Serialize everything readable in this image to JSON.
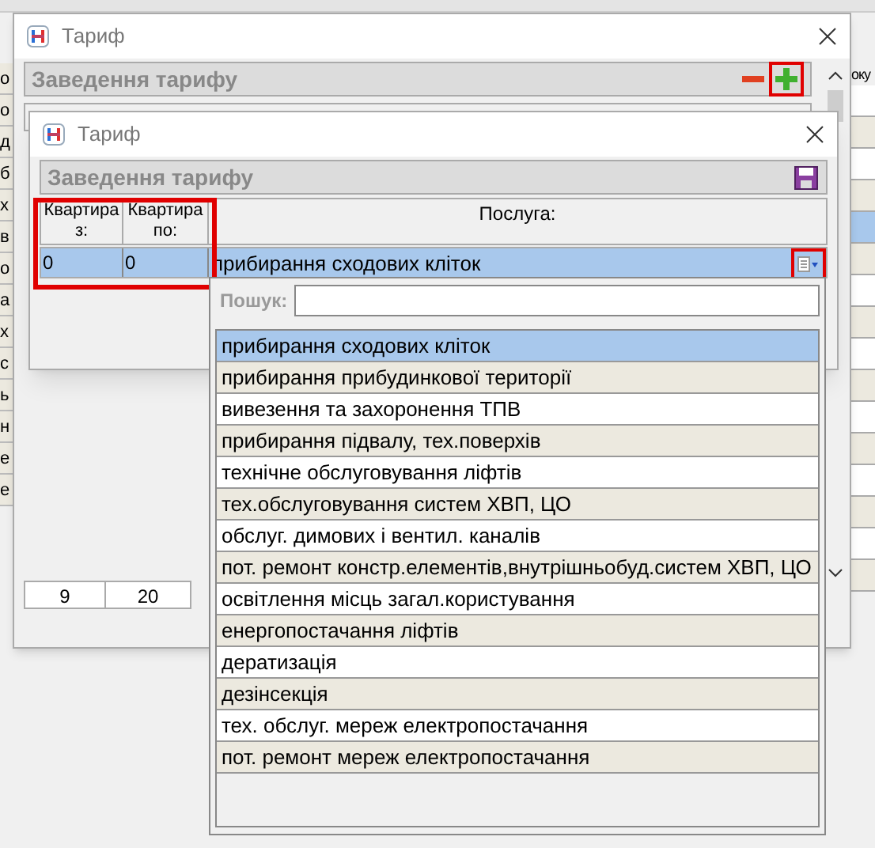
{
  "background": {
    "left_fragments": [
      "о",
      "о",
      "д",
      "б",
      "х",
      "в",
      "о",
      "а",
      "х",
      "с",
      "ь",
      "н",
      "е",
      "е"
    ],
    "right_fragment": "оку"
  },
  "back_window": {
    "title": "Тариф",
    "panel_title": "Заведення тарифу",
    "row": [
      "9",
      "20"
    ]
  },
  "front_window": {
    "title": "Тариф",
    "panel_title": "Заведення тарифу",
    "columns": [
      "Квартира з:",
      "Квартира по:",
      "Послуга:"
    ],
    "row": {
      "from": "0",
      "to": "0",
      "service": "прибирання сходових кліток",
      "selected": true
    }
  },
  "dropdown": {
    "search_label": "Пошук:",
    "items": [
      {
        "label": "прибирання сходових кліток",
        "selected": true
      },
      {
        "label": "прибирання прибудинкової території",
        "selected": false
      },
      {
        "label": "вивезення та захоронення ТПВ",
        "selected": false
      },
      {
        "label": "прибирання підвалу, тех.поверхів",
        "selected": false
      },
      {
        "label": "технічне обслуговування ліфтів",
        "selected": false
      },
      {
        "label": "тех.обслуговування систем ХВП, ЦО",
        "selected": false
      },
      {
        "label": "обслуг. димових і вентил. каналів",
        "selected": false
      },
      {
        "label": "пот. ремонт констр.елементів,внутрішньобуд.систем ХВП, ЦО",
        "selected": false
      },
      {
        "label": "освітлення місць загал.користування",
        "selected": false
      },
      {
        "label": "енергопостачання ліфтів",
        "selected": false
      },
      {
        "label": "дератизація",
        "selected": false
      },
      {
        "label": "дезінсекція",
        "selected": false
      },
      {
        "label": "тех. обслуг. мереж електропостачання",
        "selected": false
      },
      {
        "label": "пот. ремонт мереж електропостачання",
        "selected": false
      }
    ]
  }
}
